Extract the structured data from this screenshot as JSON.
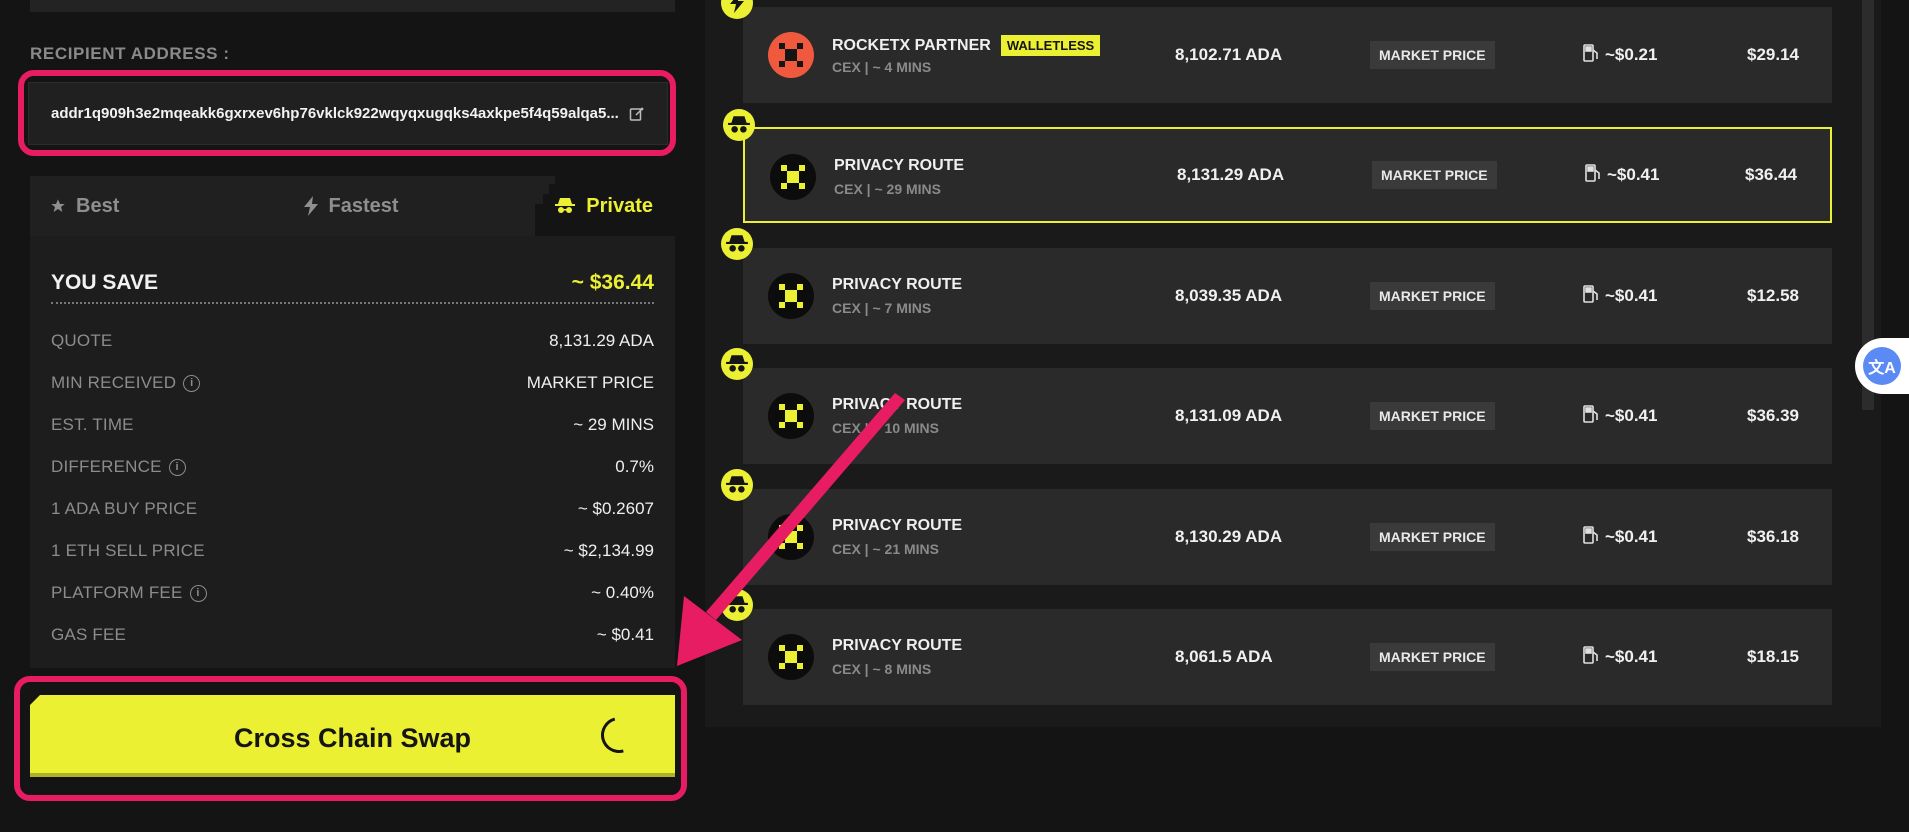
{
  "recipient": {
    "label": "RECIPIENT ADDRESS :",
    "address": "addr1q909h3e2mqeakk6gxrxev6hp76vklck922wqyqxugqks4axkpe5f4q59alqa5..."
  },
  "tabs": {
    "best": "Best",
    "fastest": "Fastest",
    "private": "Private"
  },
  "summary": {
    "save_label": "YOU SAVE",
    "save_value": "~ $36.44",
    "rows": [
      {
        "label": "QUOTE",
        "value": "8,131.29 ADA"
      },
      {
        "label": "MIN RECEIVED",
        "value": "MARKET PRICE",
        "info": "i"
      },
      {
        "label": "EST. TIME",
        "value": "~ 29 MINS"
      },
      {
        "label": "DIFFERENCE",
        "value": "0.7%",
        "info": "i"
      },
      {
        "label": "1 ADA BUY PRICE",
        "value": "~ $0.2607"
      },
      {
        "label": "1 ETH SELL PRICE",
        "value": "~ $2,134.99"
      },
      {
        "label": "PLATFORM FEE",
        "value": "~ 0.40%",
        "info": "i"
      },
      {
        "label": "GAS FEE",
        "value": "~ $0.41"
      }
    ]
  },
  "swap_button": "Cross Chain Swap",
  "routes": [
    {
      "name": "ROCKETX PARTNER",
      "tag": "WALLETLESS",
      "meta": "CEX | ~ 4 MINS",
      "amount": "8,102.71 ADA",
      "type": "MARKET PRICE",
      "gas": "~$0.21",
      "value": "$29.14",
      "badge": "lightning-icon",
      "logo": "rocketx"
    },
    {
      "name": "PRIVACY ROUTE",
      "meta": "CEX | ~ 29 MINS",
      "amount": "8,131.29 ADA",
      "type": "MARKET PRICE",
      "gas": "~$0.41",
      "value": "$36.44",
      "badge": "spy-icon",
      "selected": true
    },
    {
      "name": "PRIVACY ROUTE",
      "meta": "CEX | ~ 7 MINS",
      "amount": "8,039.35 ADA",
      "type": "MARKET PRICE",
      "gas": "~$0.41",
      "value": "$12.58",
      "badge": "spy-icon"
    },
    {
      "name": "PRIVACY ROUTE",
      "meta": "CEX | ~ 10 MINS",
      "amount": "8,131.09 ADA",
      "type": "MARKET PRICE",
      "gas": "~$0.41",
      "value": "$36.39",
      "badge": "spy-icon"
    },
    {
      "name": "PRIVACY ROUTE",
      "meta": "CEX | ~ 21 MINS",
      "amount": "8,130.29 ADA",
      "type": "MARKET PRICE",
      "gas": "~$0.41",
      "value": "$36.18",
      "badge": "spy-icon"
    },
    {
      "name": "PRIVACY ROUTE",
      "meta": "CEX | ~ 8 MINS",
      "amount": "8,061.5 ADA",
      "type": "MARKET PRICE",
      "gas": "~$0.41",
      "value": "$18.15",
      "badge": "spy-icon"
    }
  ],
  "colors": {
    "accent": "#ecf033",
    "highlight": "#e81c62",
    "panel": "#1d1d1d",
    "background": "#141414"
  }
}
